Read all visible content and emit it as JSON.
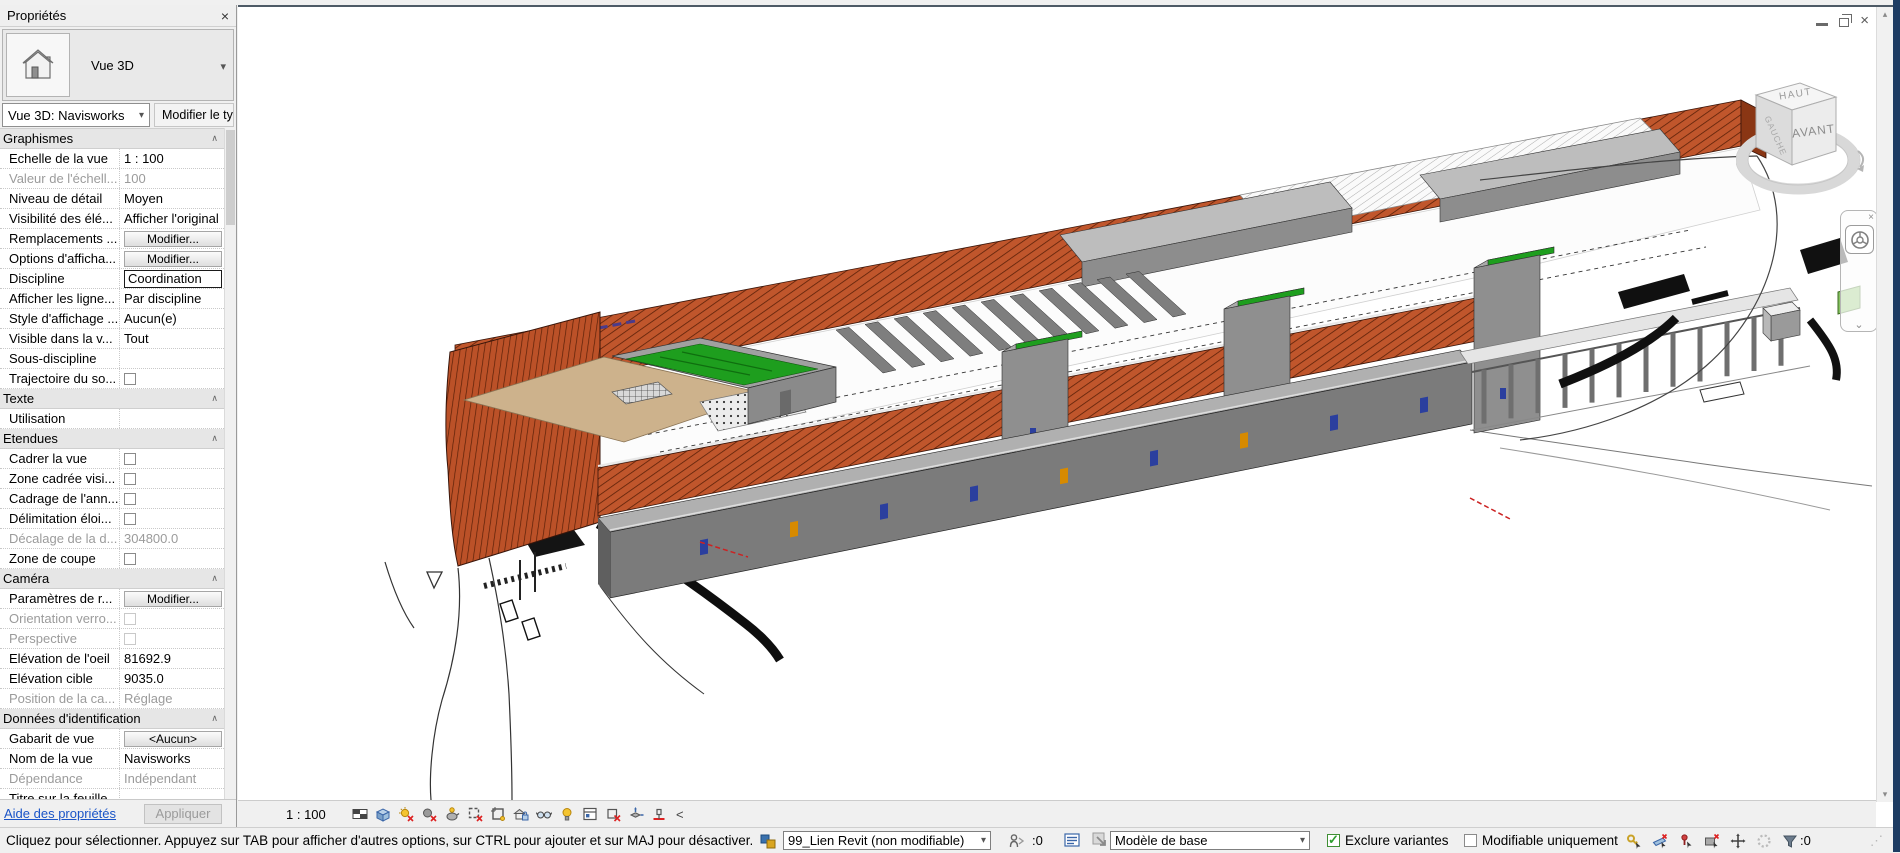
{
  "app": {
    "status_message": "Cliquez pour sélectionner. Appuyez sur TAB pour afficher d'autres options, sur CTRL pour ajouter et sur MAJ pour désactiver."
  },
  "icons": {
    "combo_arrow": "▾",
    "section_collapse": "∧",
    "close": "×",
    "scroll_up": "▴",
    "scroll_down": "▾",
    "nav_chevron": "⌄",
    "grip": "⋰"
  },
  "properties_panel": {
    "title": "Propriétés",
    "type_label": "Vue 3D",
    "selector_value": "Vue 3D: Navisworks",
    "edit_type_label": "Modifier le type",
    "help_link": "Aide des propriétés",
    "apply_label": "Appliquer",
    "sections": [
      {
        "label": "Graphismes",
        "rows": [
          {
            "label": "Echelle de la vue",
            "value": "1 : 100",
            "type": "text"
          },
          {
            "label": "Valeur de l'échell...",
            "value": "100",
            "type": "text",
            "disabled": true
          },
          {
            "label": "Niveau de détail",
            "value": "Moyen",
            "type": "text"
          },
          {
            "label": "Visibilité des élé...",
            "value": "Afficher l'original",
            "type": "text"
          },
          {
            "label": "Remplacements ...",
            "value": "Modifier...",
            "type": "button"
          },
          {
            "label": "Options d'afficha...",
            "value": "Modifier...",
            "type": "button"
          },
          {
            "label": "Discipline",
            "value": "Coordination",
            "type": "combo"
          },
          {
            "label": "Afficher les ligne...",
            "value": "Par discipline",
            "type": "text"
          },
          {
            "label": "Style d'affichage ...",
            "value": "Aucun(e)",
            "type": "text"
          },
          {
            "label": "Visible dans la v...",
            "value": "Tout",
            "type": "text"
          },
          {
            "label": "Sous-discipline",
            "value": "",
            "type": "text"
          },
          {
            "label": "Trajectoire du so...",
            "value": "",
            "type": "checkbox",
            "checked": false
          }
        ]
      },
      {
        "label": "Texte",
        "rows": [
          {
            "label": "Utilisation",
            "value": "",
            "type": "text"
          }
        ]
      },
      {
        "label": "Etendues",
        "rows": [
          {
            "label": "Cadrer la vue",
            "value": "",
            "type": "checkbox",
            "checked": false
          },
          {
            "label": "Zone cadrée visi...",
            "value": "",
            "type": "checkbox",
            "checked": false
          },
          {
            "label": "Cadrage de l'ann...",
            "value": "",
            "type": "checkbox",
            "checked": false
          },
          {
            "label": "Délimitation éloi...",
            "value": "",
            "type": "checkbox",
            "checked": false
          },
          {
            "label": "Décalage de la d...",
            "value": "304800.0",
            "type": "text",
            "disabled": true
          },
          {
            "label": "Zone de coupe",
            "value": "",
            "type": "checkbox",
            "checked": false
          }
        ]
      },
      {
        "label": "Caméra",
        "rows": [
          {
            "label": "Paramètres de r...",
            "value": "Modifier...",
            "type": "button"
          },
          {
            "label": "Orientation verro...",
            "value": "",
            "type": "checkbox",
            "checked": false,
            "disabled": true
          },
          {
            "label": "Perspective",
            "value": "",
            "type": "checkbox",
            "checked": false,
            "disabled": true
          },
          {
            "label": "Elévation de l'oeil",
            "value": "81692.9",
            "type": "text"
          },
          {
            "label": "Elévation cible",
            "value": "9035.0",
            "type": "text"
          },
          {
            "label": "Position de la ca...",
            "value": "Réglage",
            "type": "text",
            "disabled": true
          }
        ]
      },
      {
        "label": "Données d'identification",
        "rows": [
          {
            "label": "Gabarit de vue",
            "value": "<Aucun>",
            "type": "button"
          },
          {
            "label": "Nom de la vue",
            "value": "Navisworks",
            "type": "text"
          },
          {
            "label": "Dépendance",
            "value": "Indépendant",
            "type": "text",
            "disabled": true
          },
          {
            "label": "Titre sur la feuille",
            "value": "",
            "type": "text"
          }
        ]
      }
    ]
  },
  "view_control_bar": {
    "scale": "1 : 100",
    "collapse_icon": "<",
    "icons": [
      "detail-level",
      "visual-style",
      "sun-path",
      "shadows",
      "rendering-dialog",
      "crop-view",
      "show-crop-region",
      "locked-3d-view",
      "temporary-hide-isolate",
      "reveal-hidden-elements",
      "temporary-view-properties",
      "analytical-model",
      "displacement-sets",
      "reveal-constraints"
    ]
  },
  "viewcube": {
    "top": "HAUT",
    "front": "AVANT",
    "left": "GAUCHE"
  },
  "statusbar": {
    "workset_value": "99_Lien Revit (non modifiable)",
    "editing_requests_count": ":0",
    "design_option_value": "Modèle de base",
    "exclude_options_label": "Exclure variantes",
    "exclude_options_checked": true,
    "editable_only_label": "Modifiable uniquement",
    "editable_only_checked": false,
    "filter_count": ":0",
    "selection_icons": [
      "select-links",
      "select-underlay-elements",
      "select-pinned-elements",
      "select-elements-by-face",
      "drag-elements-on-selection",
      "selection-spinner",
      "filter"
    ]
  },
  "colors": {
    "facade_orange": "#c0562c",
    "facade_dark": "#8a3614",
    "model_gray": "#7b7b7b",
    "roof_green": "#1e9e1e",
    "terrace_tan": "#cdb28c",
    "window_blue": "#3f51b5",
    "frame_navy": "#1d3c63",
    "check_green": "#2f9e2f",
    "link_blue": "#1a54c7"
  }
}
